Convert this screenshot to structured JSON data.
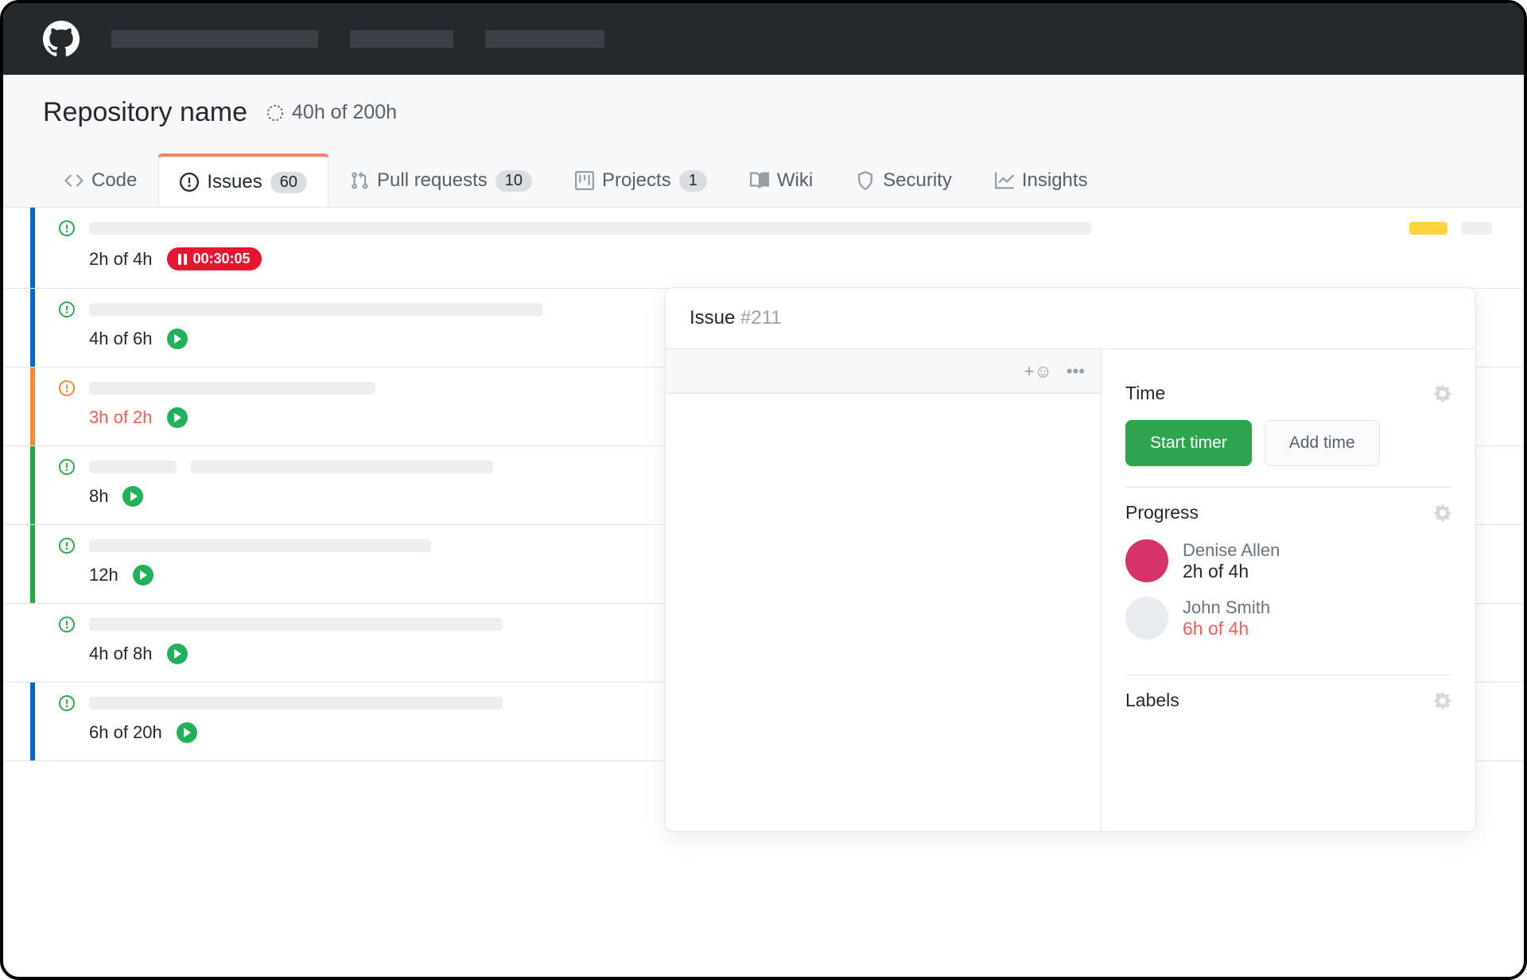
{
  "repo": {
    "name": "Repository name",
    "budget": "40h of 200h"
  },
  "tabs": {
    "code": "Code",
    "issues": {
      "label": "Issues",
      "count": "60"
    },
    "pulls": {
      "label": "Pull requests",
      "count": "10"
    },
    "projects": {
      "label": "Projects",
      "count": "1"
    },
    "wiki": "Wiki",
    "security": "Security",
    "insights": "Insights"
  },
  "issues": [
    {
      "time": "2h of 4h",
      "timer": "00:30:05"
    },
    {
      "time": "4h of 6h"
    },
    {
      "time": "3h of 2h"
    },
    {
      "time": "8h"
    },
    {
      "time": "12h"
    },
    {
      "time": "4h of 8h"
    },
    {
      "time": "6h of 20h"
    }
  ],
  "panel": {
    "title_prefix": "Issue ",
    "title_num": "#211",
    "sections": {
      "time": {
        "title": "Time",
        "start": "Start timer",
        "add": "Add time"
      },
      "progress": {
        "title": "Progress",
        "people": [
          {
            "name": "Denise Allen",
            "time": "2h of 4h",
            "over": false,
            "avbg": "#d6336c"
          },
          {
            "name": "John Smith",
            "time": "6h of 4h",
            "over": true,
            "avbg": "#e9ecef"
          }
        ]
      },
      "labels": {
        "title": "Labels"
      }
    }
  }
}
